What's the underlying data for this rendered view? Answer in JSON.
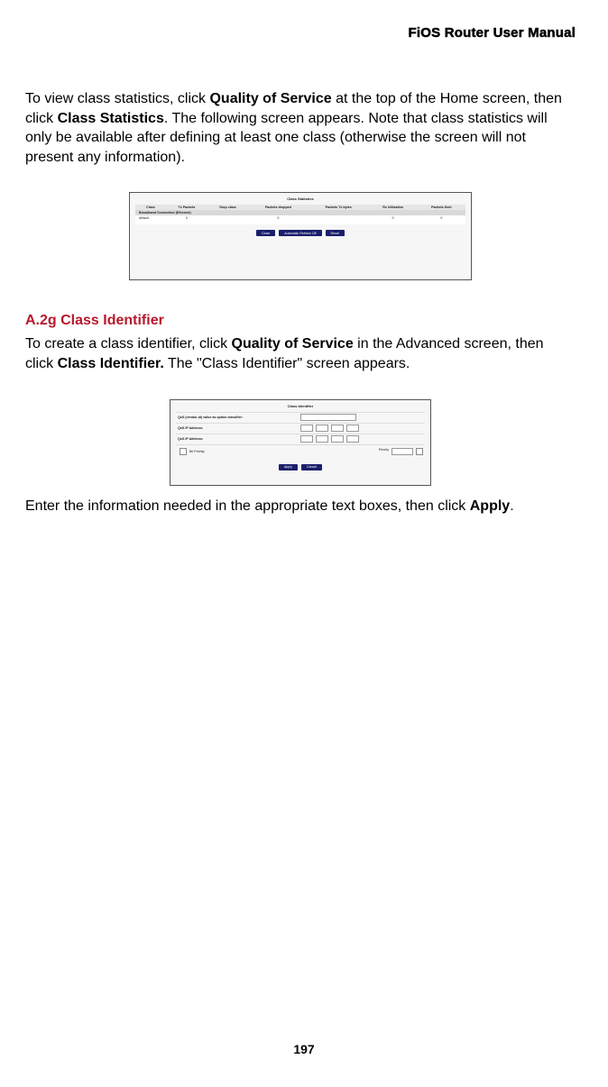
{
  "header": {
    "manual_title": "FiOS Router User Manual"
  },
  "intro": {
    "p1_pre": "To view class statistics, click ",
    "p1_link1": "Quality of Service",
    "p1_mid": " at the top of the Home screen, then click ",
    "p1_link2": "Class Statistics",
    "p1_post": ". The following screen appears. Note that class statistics will only be available after defining at least one class (otherwise the screen will not present any information)."
  },
  "fig1": {
    "title": "Class Statistics",
    "cols": [
      "Class",
      "Tx Packets",
      "Drop class",
      "Packets dropped",
      "Packets Tx bytes",
      "Rx Utilization",
      "Packets Sent"
    ],
    "subhead": "Broadband Connection (Ethernet)",
    "rows": [
      [
        "default",
        "0",
        "",
        "0",
        "",
        "0",
        "0"
      ],
      [
        "",
        "",
        "",
        "",
        "",
        "",
        ""
      ],
      [
        "",
        "",
        "",
        "",
        "",
        "",
        ""
      ]
    ],
    "buttons": [
      "Close",
      "Automatic Refresh Off",
      "Reset"
    ]
  },
  "section": {
    "heading": "A.2g  Class Identifier",
    "p2_pre": "To create a class identifier, click ",
    "p2_link1": "Quality of Service",
    "p2_mid": " in the Advanced screen, then click ",
    "p2_link2": "Class Identifier.",
    "p2_post": " The \"Class Identifier\" screen appears."
  },
  "fig2": {
    "title": "Class Identifier",
    "row1_label": "QoS (vendor-id) value as option classifier:",
    "row2_label": "QoS IP Address:",
    "row3_label": "QoS IP Address:",
    "check_label": "Bit Priority.",
    "extra_label": "Priority",
    "buttons": [
      "Apply",
      "Cancel"
    ]
  },
  "closing": {
    "p3_pre": "Enter the information needed in the appropriate text boxes, then click ",
    "p3_link": "Apply",
    "p3_post": "."
  },
  "page_number": "197"
}
